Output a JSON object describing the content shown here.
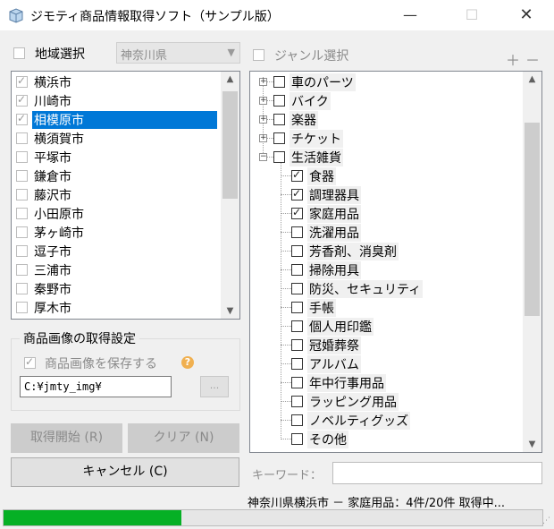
{
  "window": {
    "title": "ジモティ商品情報取得ソフト（サンプル版）",
    "buttons": {
      "minimize": "—",
      "maximize": "☐",
      "close": "✕"
    }
  },
  "region": {
    "checkbox_label": "地域選択",
    "checked": false,
    "prefecture_value": "神奈川県",
    "cities": [
      {
        "name": "横浜市",
        "checked": true,
        "selected": false
      },
      {
        "name": "川崎市",
        "checked": true,
        "selected": false
      },
      {
        "name": "相模原市",
        "checked": true,
        "selected": true
      },
      {
        "name": "横須賀市",
        "checked": false,
        "selected": false
      },
      {
        "name": "平塚市",
        "checked": false,
        "selected": false
      },
      {
        "name": "鎌倉市",
        "checked": false,
        "selected": false
      },
      {
        "name": "藤沢市",
        "checked": false,
        "selected": false
      },
      {
        "name": "小田原市",
        "checked": false,
        "selected": false
      },
      {
        "name": "茅ヶ崎市",
        "checked": false,
        "selected": false
      },
      {
        "name": "逗子市",
        "checked": false,
        "selected": false
      },
      {
        "name": "三浦市",
        "checked": false,
        "selected": false
      },
      {
        "name": "秦野市",
        "checked": false,
        "selected": false
      },
      {
        "name": "厚木市",
        "checked": false,
        "selected": false
      }
    ]
  },
  "image_settings": {
    "group_title": "商品画像の取得設定",
    "save_label": "商品画像を保存する",
    "save_checked": true,
    "help_glyph": "?",
    "path_value": "C:¥jmty_img¥",
    "browse_label": "..."
  },
  "actions": {
    "start_label": "取得開始 (R)",
    "clear_label": "クリア (N)",
    "cancel_label": "キャンセル (C)"
  },
  "genre": {
    "checkbox_label": "ジャンル選択",
    "checked": false,
    "plus_label": "＋",
    "minus_label": "－",
    "tree": [
      {
        "label": "車のパーツ",
        "level": 0,
        "expander": "+",
        "checked": false
      },
      {
        "label": "バイク",
        "level": 0,
        "expander": "+",
        "checked": false
      },
      {
        "label": "楽器",
        "level": 0,
        "expander": "+",
        "checked": false
      },
      {
        "label": "チケット",
        "level": 0,
        "expander": "+",
        "checked": false
      },
      {
        "label": "生活雑貨",
        "level": 0,
        "expander": "−",
        "checked": false
      },
      {
        "label": "食器",
        "level": 1,
        "checked": true
      },
      {
        "label": "調理器具",
        "level": 1,
        "checked": true
      },
      {
        "label": "家庭用品",
        "level": 1,
        "checked": true
      },
      {
        "label": "洗濯用品",
        "level": 1,
        "checked": false
      },
      {
        "label": "芳香剤、消臭剤",
        "level": 1,
        "checked": false
      },
      {
        "label": "掃除用具",
        "level": 1,
        "checked": false
      },
      {
        "label": "防災、セキュリティ",
        "level": 1,
        "checked": false
      },
      {
        "label": "手帳",
        "level": 1,
        "checked": false
      },
      {
        "label": "個人用印鑑",
        "level": 1,
        "checked": false
      },
      {
        "label": "冠婚葬祭",
        "level": 1,
        "checked": false
      },
      {
        "label": "アルバム",
        "level": 1,
        "checked": false
      },
      {
        "label": "年中行事用品",
        "level": 1,
        "checked": false
      },
      {
        "label": "ラッピング用品",
        "level": 1,
        "checked": false
      },
      {
        "label": "ノベルティグッズ",
        "level": 1,
        "checked": false
      },
      {
        "label": "その他",
        "level": 1,
        "checked": false
      }
    ]
  },
  "keyword": {
    "label": "キーワード：",
    "value": ""
  },
  "status": {
    "text": "神奈川県横浜市 － 家庭用品：4件/20件 取得中...",
    "progress": 0.33
  },
  "colors": {
    "selection": "#0078d7",
    "progress": "#06b025"
  }
}
